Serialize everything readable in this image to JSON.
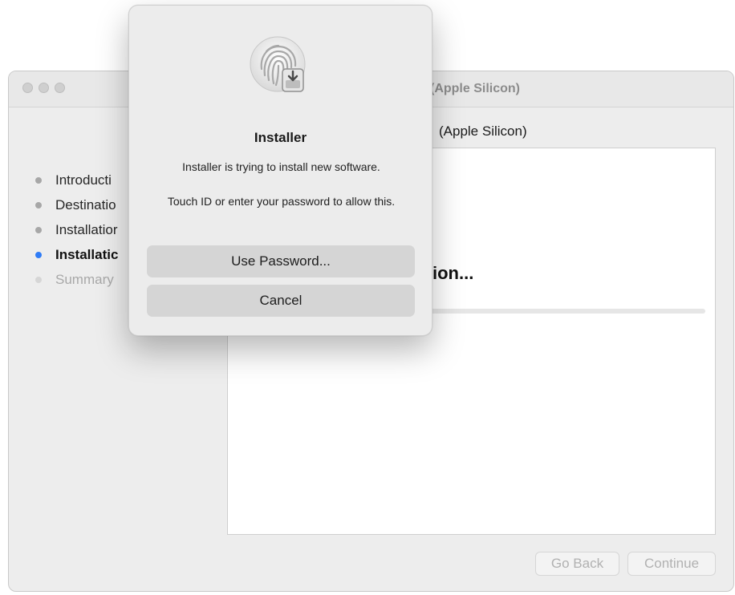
{
  "window": {
    "title": "(Apple Silicon)",
    "subtitle": "(Apple Silicon)"
  },
  "sidebar": {
    "steps": [
      {
        "label": "Introducti",
        "state": "done"
      },
      {
        "label": "Destinatio",
        "state": "done"
      },
      {
        "label": "Installatior",
        "state": "done"
      },
      {
        "label": "Installatic",
        "state": "active"
      },
      {
        "label": "Summary",
        "state": "future"
      }
    ]
  },
  "main": {
    "heading": "ion..."
  },
  "footer": {
    "go_back_label": "Go Back",
    "continue_label": "Continue"
  },
  "dialog": {
    "icon": "touch-id-fingerprint-installer-icon",
    "title": "Installer",
    "message": "Installer is trying to install new software.",
    "prompt": "Touch ID or enter your password to allow this.",
    "use_password_label": "Use Password...",
    "cancel_label": "Cancel"
  },
  "colors": {
    "accent_dot": "#2f7cf6",
    "window_bg": "#ededed",
    "button_bg": "#d5d5d5"
  }
}
